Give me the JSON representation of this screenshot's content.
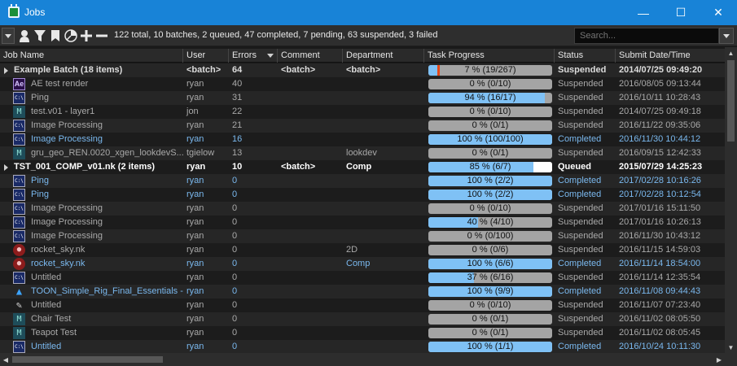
{
  "window": {
    "title": "Jobs",
    "minimize": "—",
    "maximize": "☐",
    "close": "✕"
  },
  "toolbar": {
    "summary": "122 total, 10 batches, 2 queued, 47 completed, 7 pending, 63 suspended, 3 failed",
    "search_placeholder": "Search..."
  },
  "columns": [
    "Job Name",
    "User",
    "Errors",
    "Comment",
    "Department",
    "Task Progress",
    "Status",
    "Submit Date/Time"
  ],
  "colors": {
    "progress_fill": "#7fc1f5",
    "progress_bg": "#a4a4a4",
    "failed_fill": "#e34a1c",
    "titlebar": "#1883d7"
  },
  "rows": [
    {
      "kind": "batch",
      "name": "Example Batch (18 items)",
      "user": "<batch>",
      "errors": "64",
      "comment": "<batch>",
      "department": "<batch>",
      "progress": "7 %  (19/267)",
      "progress_value": 0.07,
      "failed_value": 0.02,
      "status": "Suspended",
      "date": "2014/07/25 09:49:20",
      "tone": "bold"
    },
    {
      "kind": "job",
      "icon": "ae-icon",
      "name": "AE test render",
      "user": "ryan",
      "errors": "40",
      "comment": "",
      "department": "",
      "progress": "0 %  (0/10)",
      "progress_value": 0,
      "status": "Suspended",
      "date": "2016/08/05 09:13:44",
      "tone": "gray"
    },
    {
      "kind": "job",
      "icon": "command-icon",
      "name": "Ping",
      "user": "ryan",
      "errors": "31",
      "comment": "",
      "department": "",
      "progress": "94 %  (16/17)",
      "progress_value": 0.94,
      "status": "Suspended",
      "date": "2016/10/11 10:28:43",
      "tone": "gray"
    },
    {
      "kind": "job",
      "icon": "maya-icon",
      "name": "test.v01 - layer1",
      "user": "jon",
      "errors": "22",
      "comment": "",
      "department": "",
      "progress": "0 %  (0/10)",
      "progress_value": 0,
      "status": "Suspended",
      "date": "2014/07/25 09:49:18",
      "tone": "gray"
    },
    {
      "kind": "job",
      "icon": "command-icon",
      "name": "Image Processing",
      "user": "ryan",
      "errors": "21",
      "comment": "",
      "department": "",
      "progress": "0 %  (0/1)",
      "progress_value": 0,
      "status": "Suspended",
      "date": "2016/11/22 09:35:06",
      "tone": "gray"
    },
    {
      "kind": "job",
      "icon": "command-icon",
      "name": "Image Processing",
      "user": "ryan",
      "errors": "16",
      "comment": "",
      "department": "",
      "progress": "100 %  (100/100)",
      "progress_value": 1,
      "status": "Completed",
      "date": "2016/11/30 10:44:12",
      "tone": "blue"
    },
    {
      "kind": "job",
      "icon": "maya-icon",
      "name": "gru_geo_REN.0020_xgen_lookdevS...",
      "user": "tgielow",
      "errors": "13",
      "comment": "",
      "department": "lookdev",
      "progress": "0 %  (0/1)",
      "progress_value": 0,
      "status": "Suspended",
      "date": "2016/09/15 12:42:33",
      "tone": "gray"
    },
    {
      "kind": "batch",
      "name": "TST_001_COMP_v01.nk (2 items)",
      "user": "ryan",
      "errors": "10",
      "comment": "<batch>",
      "department": "Comp",
      "progress": "85 %  (6/7)",
      "progress_value": 0.85,
      "white_value": 0.15,
      "status": "Queued",
      "date": "2015/07/29 14:25:23",
      "tone": "white"
    },
    {
      "kind": "job",
      "icon": "command-icon",
      "name": "Ping",
      "user": "ryan",
      "errors": "0",
      "comment": "",
      "department": "",
      "progress": "100 %  (2/2)",
      "progress_value": 1,
      "status": "Completed",
      "date": "2017/02/28 10:16:26",
      "tone": "blue"
    },
    {
      "kind": "job",
      "icon": "command-icon",
      "name": "Ping",
      "user": "ryan",
      "errors": "0",
      "comment": "",
      "department": "",
      "progress": "100 %  (2/2)",
      "progress_value": 1,
      "status": "Completed",
      "date": "2017/02/28 10:12:54",
      "tone": "blue"
    },
    {
      "kind": "job",
      "icon": "command-icon",
      "name": "Image Processing",
      "user": "ryan",
      "errors": "0",
      "comment": "",
      "department": "",
      "progress": "0 %  (0/10)",
      "progress_value": 0,
      "status": "Suspended",
      "date": "2017/01/16 15:11:50",
      "tone": "gray"
    },
    {
      "kind": "job",
      "icon": "command-icon",
      "name": "Image Processing",
      "user": "ryan",
      "errors": "0",
      "comment": "",
      "department": "",
      "progress": "40 %  (4/10)",
      "progress_value": 0.4,
      "status": "Suspended",
      "date": "2017/01/16 10:26:13",
      "tone": "gray"
    },
    {
      "kind": "job",
      "icon": "command-icon",
      "name": "Image Processing",
      "user": "ryan",
      "errors": "0",
      "comment": "",
      "department": "",
      "progress": "0 %  (0/100)",
      "progress_value": 0,
      "status": "Suspended",
      "date": "2016/11/30 10:43:12",
      "tone": "gray"
    },
    {
      "kind": "job",
      "icon": "nuke-icon",
      "name": "rocket_sky.nk",
      "user": "ryan",
      "errors": "0",
      "comment": "",
      "department": "2D",
      "progress": "0 %  (0/6)",
      "progress_value": 0,
      "status": "Suspended",
      "date": "2016/11/15 14:59:03",
      "tone": "gray"
    },
    {
      "kind": "job",
      "icon": "nuke-icon",
      "name": "rocket_sky.nk",
      "user": "ryan",
      "errors": "0",
      "comment": "",
      "department": "Comp",
      "progress": "100 %  (6/6)",
      "progress_value": 1,
      "status": "Completed",
      "date": "2016/11/14 18:54:00",
      "tone": "blue"
    },
    {
      "kind": "job",
      "icon": "command-icon",
      "name": "Untitled",
      "user": "ryan",
      "errors": "0",
      "comment": "",
      "department": "",
      "progress": "37 %  (6/16)",
      "progress_value": 0.37,
      "status": "Suspended",
      "date": "2016/11/14 12:35:54",
      "tone": "gray"
    },
    {
      "kind": "job",
      "icon": "triangle-icon",
      "name": "TOON_Simple_Rig_Final_Essentials -...",
      "user": "ryan",
      "errors": "0",
      "comment": "",
      "department": "",
      "progress": "100 %  (9/9)",
      "progress_value": 1,
      "status": "Completed",
      "date": "2016/11/08 09:44:43",
      "tone": "blue"
    },
    {
      "kind": "job",
      "icon": "tool-icon",
      "name": "Untitled",
      "user": "ryan",
      "errors": "0",
      "comment": "",
      "department": "",
      "progress": "0 %  (0/10)",
      "progress_value": 0,
      "status": "Suspended",
      "date": "2016/11/07 07:23:40",
      "tone": "gray"
    },
    {
      "kind": "job",
      "icon": "maya-icon",
      "name": "Chair Test",
      "user": "ryan",
      "errors": "0",
      "comment": "",
      "department": "",
      "progress": "0 %  (0/1)",
      "progress_value": 0,
      "status": "Suspended",
      "date": "2016/11/02 08:05:50",
      "tone": "gray"
    },
    {
      "kind": "job",
      "icon": "maya-icon",
      "name": "Teapot Test",
      "user": "ryan",
      "errors": "0",
      "comment": "",
      "department": "",
      "progress": "0 %  (0/1)",
      "progress_value": 0,
      "status": "Suspended",
      "date": "2016/11/02 08:05:45",
      "tone": "gray"
    },
    {
      "kind": "job",
      "icon": "command-icon",
      "name": "Untitled",
      "user": "ryan",
      "errors": "0",
      "comment": "",
      "department": "",
      "progress": "100 %  (1/1)",
      "progress_value": 1,
      "status": "Completed",
      "date": "2016/10/24 10:11:30",
      "tone": "blue"
    }
  ]
}
